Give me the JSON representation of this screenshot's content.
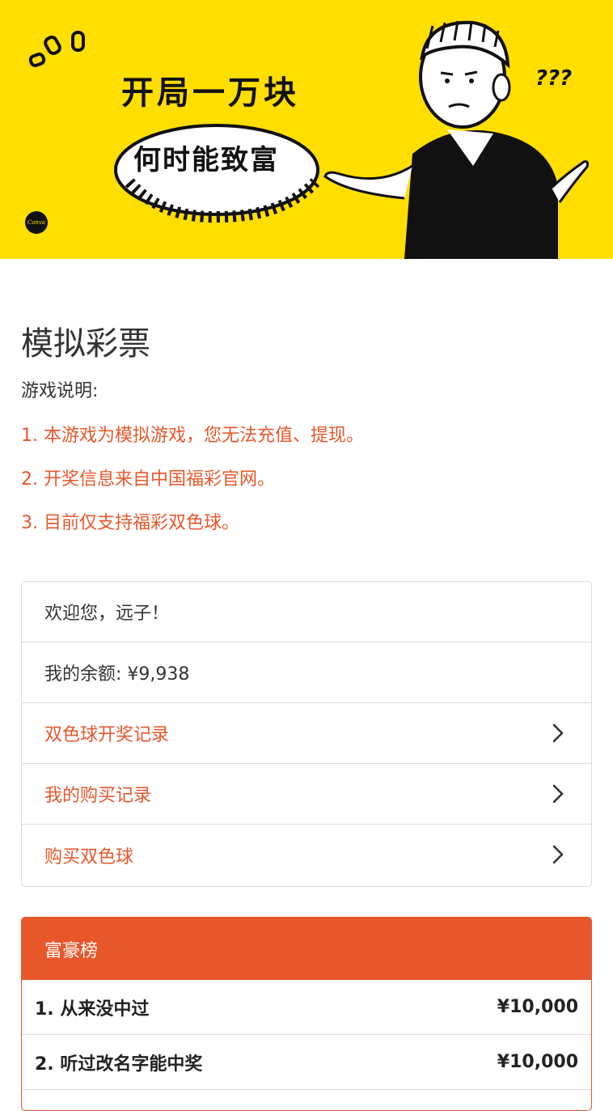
{
  "banner": {
    "title": "开局一万块",
    "subtitle": "何时能致富",
    "question_marks": "???",
    "badge": "Canva",
    "colors": {
      "background": "#FFDE00",
      "ink": "#111111"
    }
  },
  "page_title": "模拟彩票",
  "intro": {
    "label": "游戏说明:",
    "rules": [
      "1. 本游戏为模拟游戏，您无法充值、提现。",
      "2. 开奖信息来自中国福彩官网。",
      "3. 目前仅支持福彩双色球。"
    ]
  },
  "account": {
    "welcome": "欢迎您，远子！",
    "balance": "我的余额: ¥9,938",
    "links": [
      {
        "label": "双色球开奖记录",
        "icon": "chevron-right-icon"
      },
      {
        "label": "我的购买记录",
        "icon": "chevron-right-icon"
      },
      {
        "label": "购买双色球",
        "icon": "chevron-right-icon"
      }
    ]
  },
  "leaderboard": {
    "title": "富豪榜",
    "rows": [
      {
        "name": "1. 从来没中过",
        "amount": "¥10,000"
      },
      {
        "name": "2. 听过改名字能中奖",
        "amount": "¥10,000"
      }
    ]
  },
  "colors": {
    "accent": "#E8572A",
    "border": "#DCDCDC",
    "text": "#333333"
  }
}
